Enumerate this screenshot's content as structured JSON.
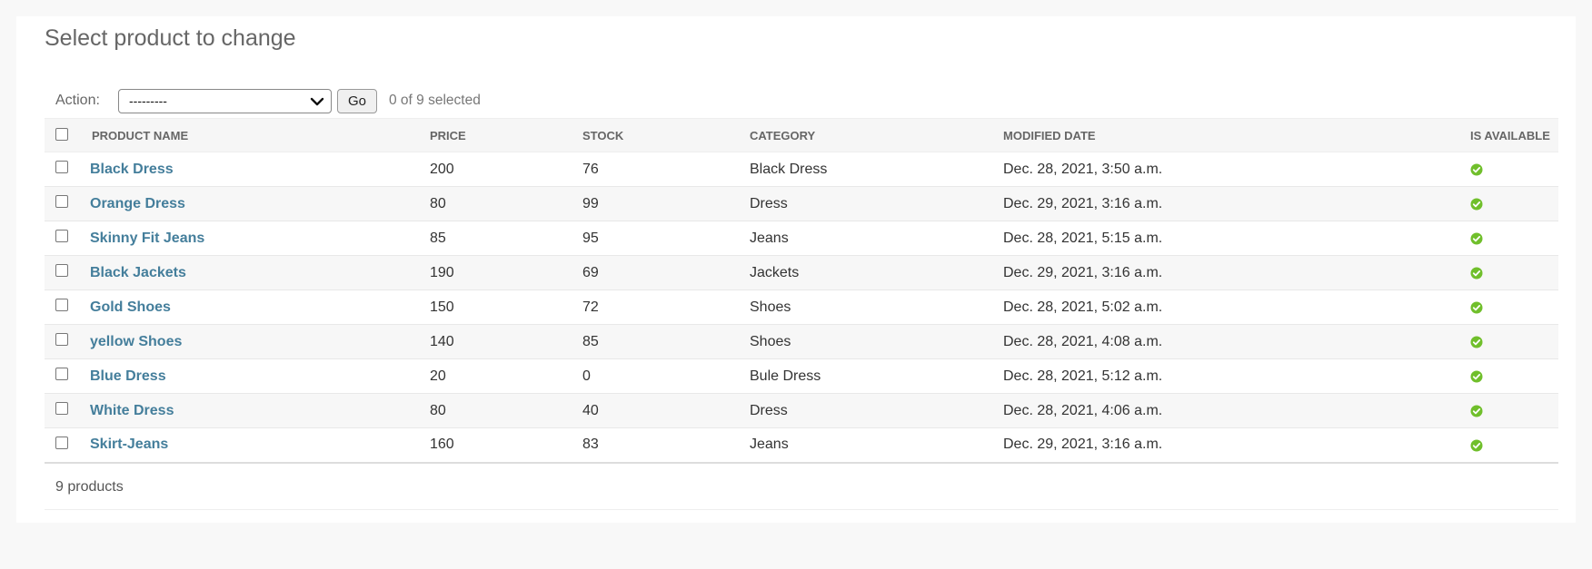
{
  "page": {
    "title": "Select product to change"
  },
  "actions": {
    "label": "Action:",
    "select_value": "---------",
    "go_label": "Go",
    "selection_count": "0 of 9 selected"
  },
  "table": {
    "headers": {
      "name": "PRODUCT NAME",
      "price": "PRICE",
      "stock": "STOCK",
      "category": "CATEGORY",
      "modified": "MODIFIED DATE",
      "available": "IS AVAILABLE"
    },
    "rows": [
      {
        "name": "Black Dress",
        "price": "200",
        "stock": "76",
        "category": "Black Dress",
        "modified": "Dec. 28, 2021, 3:50 a.m.",
        "available": true
      },
      {
        "name": "Orange Dress",
        "price": "80",
        "stock": "99",
        "category": "Dress",
        "modified": "Dec. 29, 2021, 3:16 a.m.",
        "available": true
      },
      {
        "name": "Skinny Fit Jeans",
        "price": "85",
        "stock": "95",
        "category": "Jeans",
        "modified": "Dec. 28, 2021, 5:15 a.m.",
        "available": true
      },
      {
        "name": "Black Jackets",
        "price": "190",
        "stock": "69",
        "category": "Jackets",
        "modified": "Dec. 29, 2021, 3:16 a.m.",
        "available": true
      },
      {
        "name": "Gold Shoes",
        "price": "150",
        "stock": "72",
        "category": "Shoes",
        "modified": "Dec. 28, 2021, 5:02 a.m.",
        "available": true
      },
      {
        "name": "yellow Shoes",
        "price": "140",
        "stock": "85",
        "category": "Shoes",
        "modified": "Dec. 28, 2021, 4:08 a.m.",
        "available": true
      },
      {
        "name": "Blue Dress",
        "price": "20",
        "stock": "0",
        "category": "Bule Dress",
        "modified": "Dec. 28, 2021, 5:12 a.m.",
        "available": true
      },
      {
        "name": "White Dress",
        "price": "80",
        "stock": "40",
        "category": "Dress",
        "modified": "Dec. 28, 2021, 4:06 a.m.",
        "available": true
      },
      {
        "name": "Skirt-Jeans",
        "price": "160",
        "stock": "83",
        "category": "Jeans",
        "modified": "Dec. 29, 2021, 3:16 a.m.",
        "available": true
      }
    ]
  },
  "paginator": {
    "text": "9 products"
  },
  "colors": {
    "link": "#447e9b",
    "available_icon": "#70bf2b"
  },
  "icons": {
    "available": "check-circle-icon",
    "select_caret": "chevron-down-icon"
  }
}
